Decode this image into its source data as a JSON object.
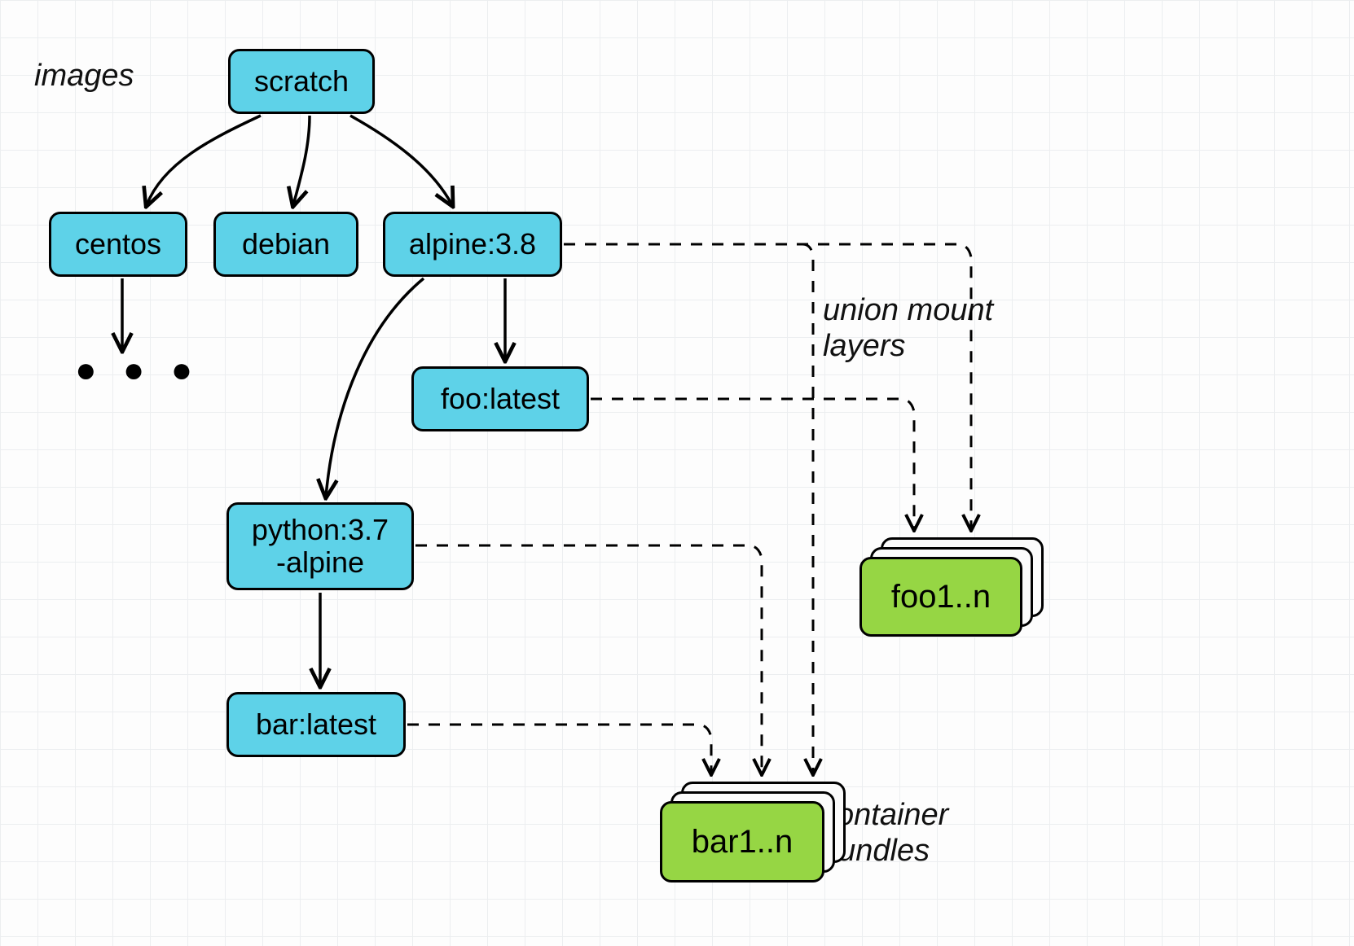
{
  "labels": {
    "images": "images",
    "union_mount_layers": "union mount\nlayers",
    "container_bundles": "container\nbundles",
    "ellipsis": "●  ●  ●"
  },
  "nodes": {
    "scratch": "scratch",
    "centos": "centos",
    "debian": "debian",
    "alpine": "alpine:3.8",
    "foo_latest": "foo:latest",
    "python_alpine": "python:3.7\n-alpine",
    "bar_latest": "bar:latest"
  },
  "bundles": {
    "foo": "foo1..n",
    "bar": "bar1..n"
  },
  "colors": {
    "node_fill": "#5ed2e8",
    "bundle_fill": "#96d644",
    "edge": "#000000"
  }
}
